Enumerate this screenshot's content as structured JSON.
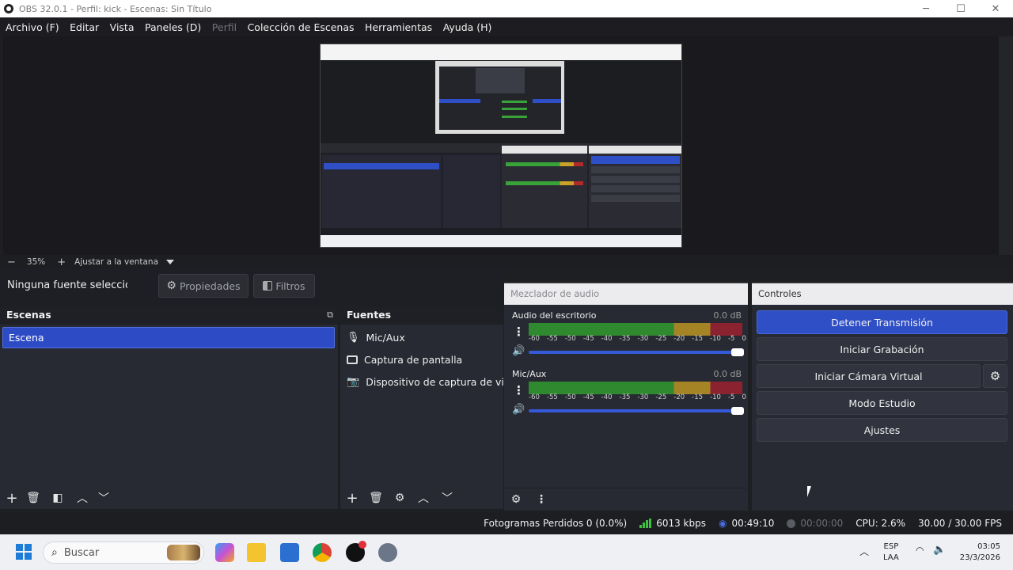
{
  "window": {
    "title": "OBS 32.0.1 - Perfil: kick - Escenas: Sin Título",
    "minimize": "─",
    "maximize": "☐",
    "close": "✕"
  },
  "menu": [
    "Archivo (F)",
    "Editar",
    "Vista",
    "Paneles (D)",
    "Perfil",
    "Colección de Escenas",
    "Herramientas",
    "Ayuda (H)"
  ],
  "zoom": {
    "minus": "−",
    "value": "35%",
    "plus": "+",
    "fit_label": "Ajustar a la ventana"
  },
  "source_toolbar": {
    "no_source": "Ninguna fuente seleccionada",
    "properties": "Propiedades",
    "filters": "Filtros"
  },
  "scenes": {
    "title": "Escenas",
    "items": [
      "Escena"
    ]
  },
  "sources": {
    "title": "Fuentes",
    "items": [
      {
        "label": "Mic/Aux",
        "icon": "microphone-icon"
      },
      {
        "label": "Captura de pantalla",
        "icon": "monitor-icon"
      },
      {
        "label": "Dispositivo de captura de video",
        "icon": "camera-icon"
      }
    ]
  },
  "mixer": {
    "title": "Mezclador de audio",
    "scale": [
      "-60",
      "-55",
      "-50",
      "-45",
      "-40",
      "-35",
      "-30",
      "-25",
      "-20",
      "-15",
      "-10",
      "-5",
      "0"
    ],
    "channels": [
      {
        "name": "Audio del escritorio",
        "db": "0.0 dB",
        "volume": 1.0
      },
      {
        "name": "Mic/Aux",
        "db": "0.0 dB",
        "volume": 1.0
      }
    ]
  },
  "controls": {
    "title": "Controles",
    "stop_stream": "Detener Transmisión",
    "start_recording": "Iniciar Grabación",
    "start_virtual_cam": "Iniciar Cámara Virtual",
    "studio_mode": "Modo Estudio",
    "settings": "Ajustes"
  },
  "status": {
    "dropped_frames": "Fotogramas Perdidos 0 (0.0%)",
    "bitrate": "6013 kbps",
    "stream_time": "00:49:10",
    "rec_time": "00:00:00",
    "cpu": "CPU: 2.6%",
    "fps": "30.00 / 30.00 FPS"
  },
  "taskbar": {
    "search_placeholder": "Buscar",
    "lang": "ESP",
    "layout": "LAA",
    "time": "03:05",
    "date": "23/3/2026"
  },
  "colors": {
    "accent": "#2f4fc7",
    "meter_green": "#2f8a2f",
    "meter_yellow": "#a48424",
    "meter_red": "#8b2230"
  }
}
